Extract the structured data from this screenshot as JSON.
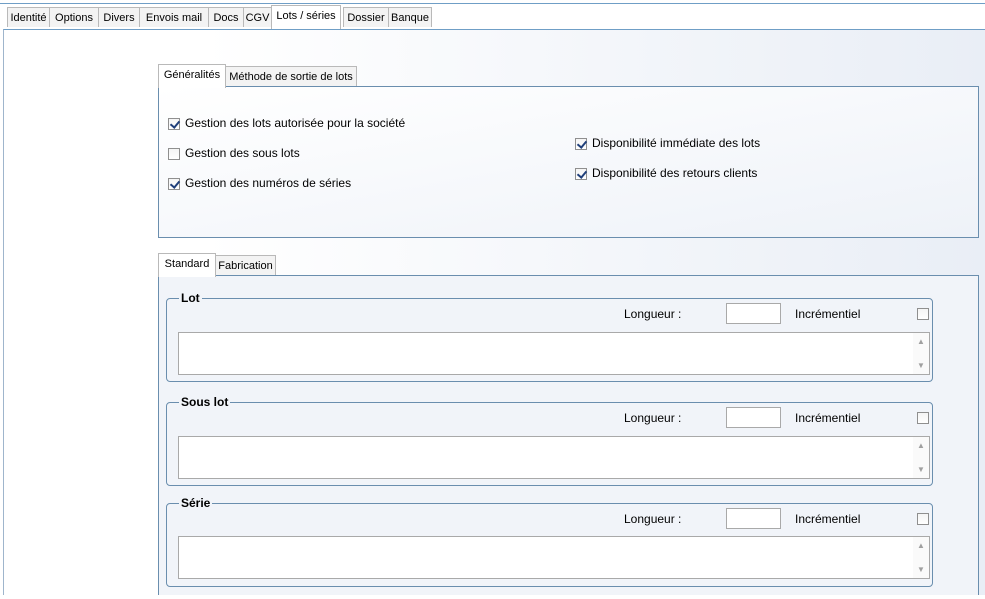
{
  "main_tabs": [
    "Identité",
    "Options",
    "Divers",
    "Envois mail",
    "Docs",
    "CGV",
    "Lots / séries",
    "Dossier",
    "Banque"
  ],
  "main_active_tab": "Lots / séries",
  "top_subtabs": {
    "items": [
      "Généralités",
      "Méthode de sortie de lots"
    ],
    "active": "Généralités"
  },
  "options": [
    {
      "label": "Gestion des lots autorisée pour la société",
      "checked": true
    },
    {
      "label": "Gestion des sous lots",
      "checked": false
    },
    {
      "label": "Gestion des numéros de séries",
      "checked": true
    },
    {
      "label": "Disponibilité immédiate des lots",
      "checked": true
    },
    {
      "label": "Disponibilité des retours clients",
      "checked": true
    }
  ],
  "bottom_subtabs": {
    "items": [
      "Standard",
      "Fabrication"
    ],
    "active": "Standard"
  },
  "groups": [
    {
      "title": "Lot",
      "length_label": "Longueur :",
      "length_value": "",
      "incremental_label": "Incrémentiel",
      "incremental_checked": false,
      "text_value": ""
    },
    {
      "title": "Sous lot",
      "length_label": "Longueur :",
      "length_value": "",
      "incremental_label": "Incrémentiel",
      "incremental_checked": false,
      "text_value": ""
    },
    {
      "title": "Série",
      "length_label": "Longueur :",
      "length_value": "",
      "incremental_label": "Incrémentiel",
      "incremental_checked": false,
      "text_value": ""
    }
  ],
  "icons": {
    "scroll_up": "scroll-up-arrow",
    "scroll_down": "scroll-down-arrow"
  }
}
